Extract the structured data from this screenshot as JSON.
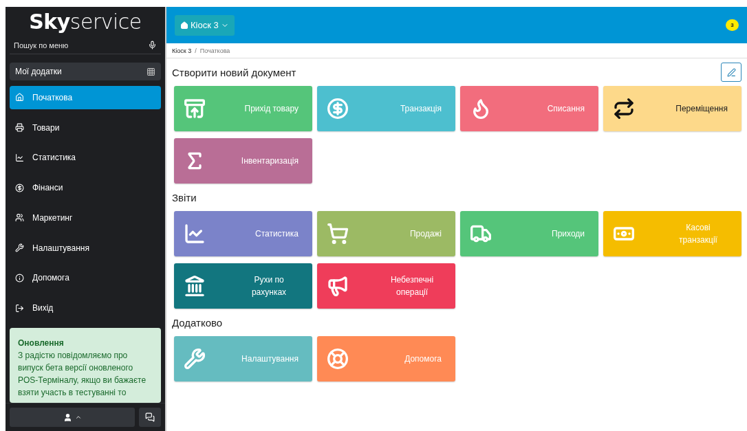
{
  "sidebar": {
    "logo": "**Sky**service",
    "search": {
      "placeholder": "Пошук по меню"
    },
    "apps_button": "Мої додатки",
    "items": [
      {
        "label": "Початкова",
        "selected": true
      },
      {
        "label": "Товари",
        "selected": false
      },
      {
        "label": "Статистика",
        "selected": false
      },
      {
        "label": "Фінанси",
        "selected": false
      },
      {
        "label": "Маркетинг",
        "selected": false
      },
      {
        "label": "Налаштування",
        "selected": false
      },
      {
        "label": "Допомога",
        "selected": false
      },
      {
        "label": "Вихід",
        "selected": false
      }
    ],
    "notice": {
      "title": "Оновлення",
      "text": "З радістю повідомляємо про випуск бета версії оновленого POS-Терміналу, якщо ви бажаєте взяти участь в тестуванні то"
    }
  },
  "topbar": {
    "store_button": "Кіоск 3",
    "notifications": "3"
  },
  "breadcrumb": {
    "separator": "/",
    "items": [
      "Кіоск 3",
      "Початкова"
    ]
  },
  "sections": [
    {
      "title": "Створити новий документ",
      "tiles": [
        {
          "label": "Прихід товару",
          "color": "#55c57a"
        },
        {
          "label": "Транзакція",
          "color": "#4dbfcf"
        },
        {
          "label": "Списання",
          "color": "#f26d7d"
        },
        {
          "label": "Переміщення",
          "color": "#fdd98a"
        },
        {
          "label": "Інвентаризація",
          "color": "#b96e96"
        }
      ]
    },
    {
      "title": "Звіти",
      "tiles": [
        {
          "label": "Статистика",
          "color": "#7b83c9"
        },
        {
          "label": "Продажі",
          "color": "#9cba64"
        },
        {
          "label": "Приходи",
          "color": "#55c57a"
        },
        {
          "label": "Касові транзакції",
          "color": "#f5bd00"
        },
        {
          "label": "Рухи по рахунках",
          "color": "#12767f"
        },
        {
          "label": "Небезпечні операції",
          "color": "#ef3d5a"
        }
      ]
    },
    {
      "title": "Додатково",
      "tiles": [
        {
          "label": "Налаштування",
          "color": "#65bcc0"
        },
        {
          "label": "Допомога",
          "color": "#ff8a55"
        }
      ]
    }
  ]
}
